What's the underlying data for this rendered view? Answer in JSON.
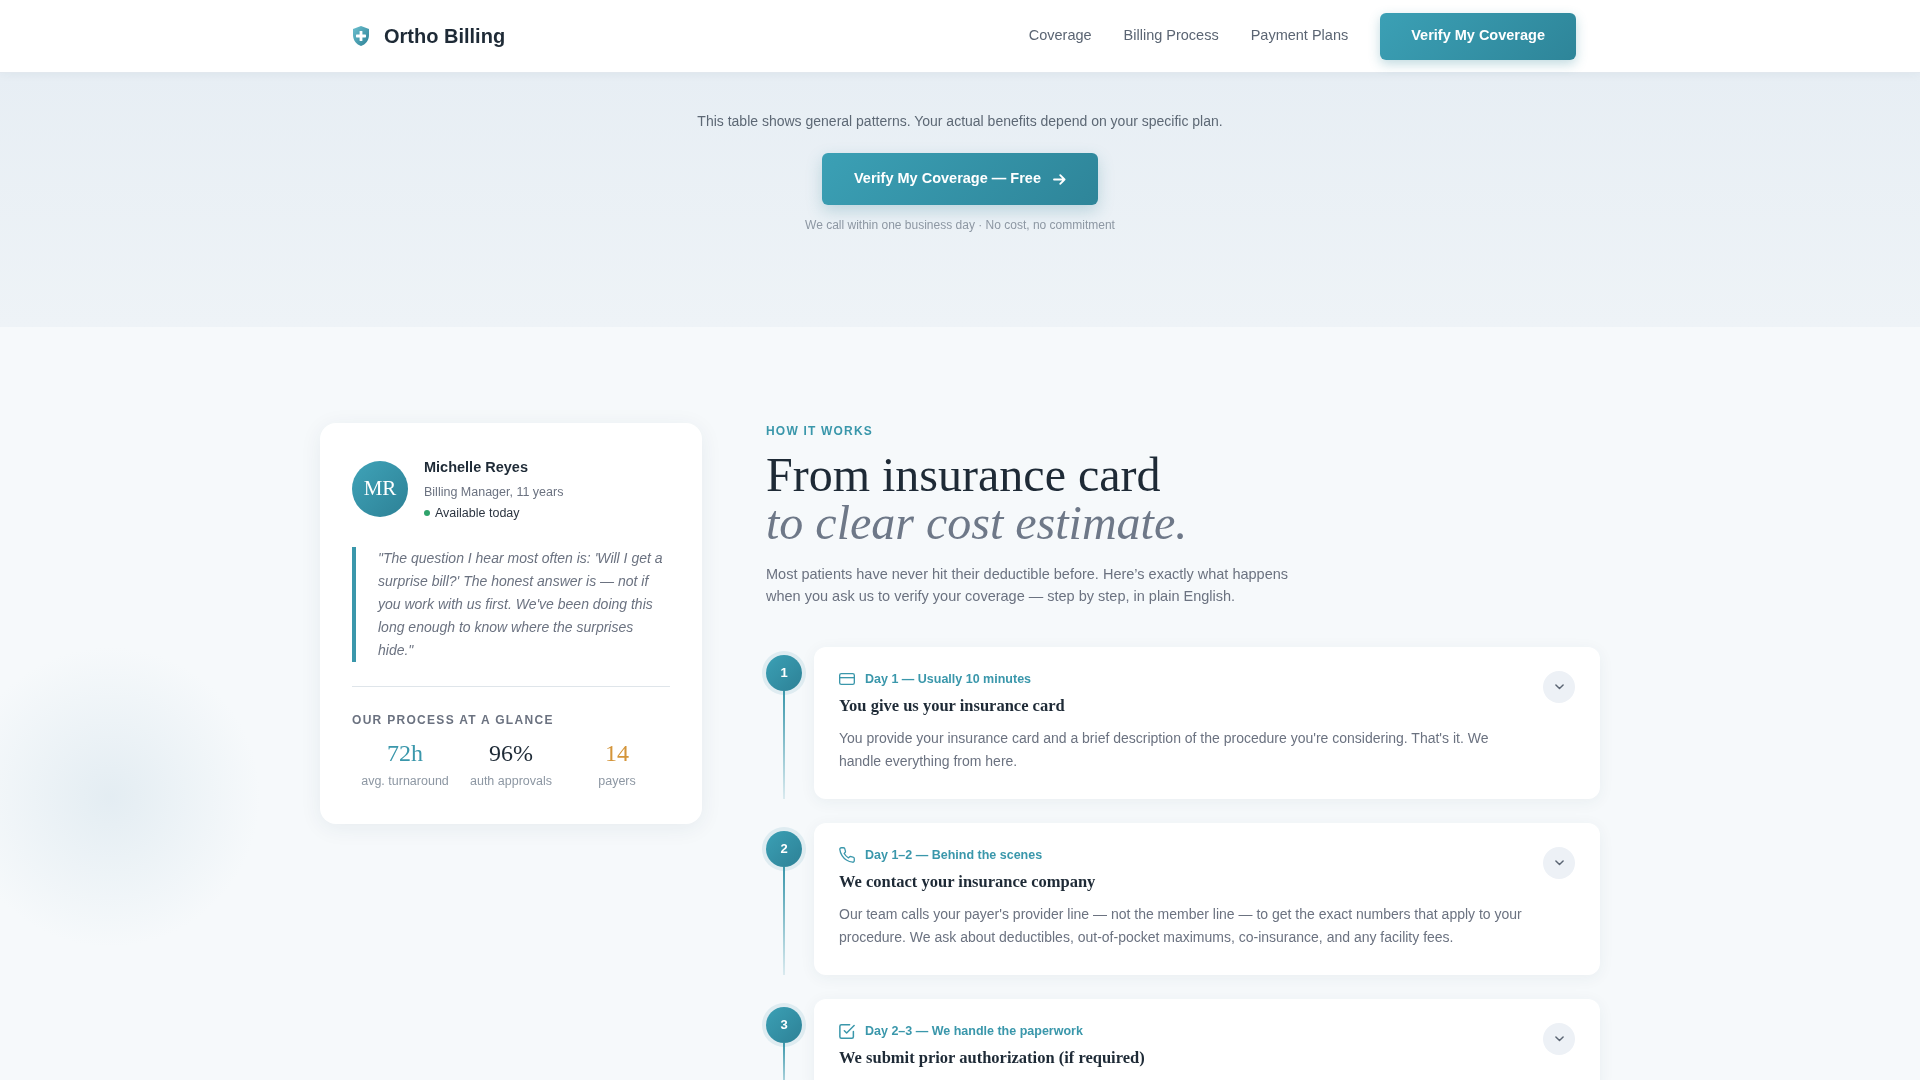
{
  "navbar": {
    "brand": "Ortho Billing",
    "links": [
      "Coverage",
      "Billing Process",
      "Payment Plans"
    ],
    "cta": "Verify My Coverage"
  },
  "hero": {
    "note": "This table shows general patterns. Your actual benefits depend on your specific plan.",
    "button": "Verify My Coverage — Free",
    "subnote": "We call within one business day · No cost, no commitment"
  },
  "profile_card": {
    "initials": "MR",
    "name": "Michelle Reyes",
    "role": "Billing Manager, 11 years",
    "availability": "Available today",
    "quote": "\"The question I hear most often is: 'Will I get a surprise bill?' The honest answer is — not if you work with us first. We've been doing this long enough to know where the surprises hide.\"",
    "stats_title": "OUR PROCESS AT A GLANCE",
    "stats": [
      {
        "value": "72h",
        "label": "avg. turnaround",
        "color": "#3a97ab"
      },
      {
        "value": "96%",
        "label": "auth approvals",
        "color": "#1e2a36"
      },
      {
        "value": "14",
        "label": "payers",
        "color": "#d4953a"
      }
    ]
  },
  "how_it_works": {
    "eyebrow": "HOW IT WORKS",
    "title": "From insurance card *to clear cost estimate.*",
    "intro": "Most patients have never hit their deductible before. Here’s exactly what happens when you ask us to verify your coverage — step by step, in plain English.",
    "steps": [
      {
        "number": "1",
        "kind": "card",
        "timing": "Day 1 — Usually 10 minutes",
        "title": "You give us your insurance card",
        "description": "You provide your insurance card and a brief description of the procedure you're considering. That's it. We handle everything from here."
      },
      {
        "number": "2",
        "kind": "phone",
        "timing": "Day 1–2 — Behind the scenes",
        "title": "We contact your insurance company",
        "description": "Our team calls your payer's provider line — not the member line — to get the exact numbers that apply to your procedure. We ask about deductibles, out-of-pocket maximums, co-insurance, and any facility fees."
      },
      {
        "number": "3",
        "kind": "checklist",
        "timing": "Day 2–3 — We handle the paperwork",
        "title": "We submit prior authorization (if required)"
      }
    ]
  }
}
